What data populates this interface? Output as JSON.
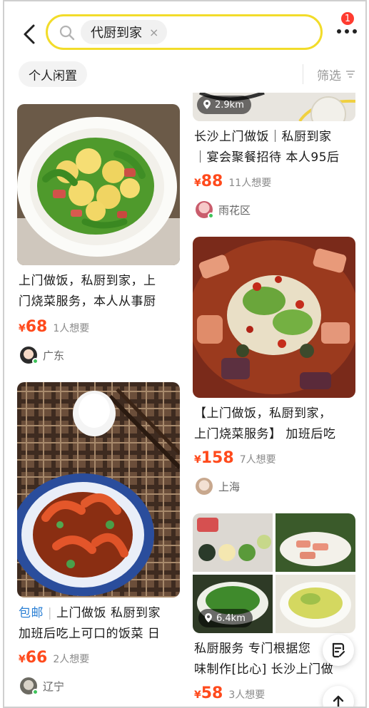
{
  "header": {
    "search_keyword": "代厨到家",
    "clear_glyph": "×",
    "notification_count": "1"
  },
  "filters": {
    "chip_label": "个人闲置",
    "filter_label": "筛选"
  },
  "listings": [
    {
      "title_line1": "长沙上门做饭｜私厨到家",
      "title_line2": "｜宴会聚餐招待 本人95后",
      "price": "88",
      "wants": "11人想要",
      "location": "雨花区",
      "distance": "2.9km",
      "image": "dish-plate"
    },
    {
      "title_line1": "上门做饭，私厨到家，上",
      "title_line2": "门烧菜服务，本人从事厨",
      "price": "68",
      "wants": "1人想要",
      "location": "广东",
      "image": "egg-pepper-stirfry"
    },
    {
      "title_line1": "【上门做饭，私厨到家，",
      "title_line2": "上门烧菜服务】 加班后吃",
      "price": "158",
      "wants": "7人想要",
      "location": "上海",
      "image": "spicy-boiled-dish"
    },
    {
      "tag": "包邮",
      "title_line1": "上门做饭 私厨到家",
      "title_line2": "加班后吃上可口的饭菜 日",
      "price": "66",
      "wants": "2人想要",
      "location": "辽宁",
      "image": "braised-shrimp"
    },
    {
      "title_line1": "私厨服务 专门根据您",
      "title_line2": "味制作[比心] 长沙上门做",
      "price": "58",
      "wants": "3人想要",
      "distance": "6.4km",
      "image": "banquet-dishes-collage"
    }
  ],
  "currency_symbol": "¥",
  "colors": {
    "search_border": "#f2dc2a",
    "price": "#ff4a1c",
    "badge": "#ff3b30",
    "free_shipping_tag": "#2a7fd4"
  }
}
